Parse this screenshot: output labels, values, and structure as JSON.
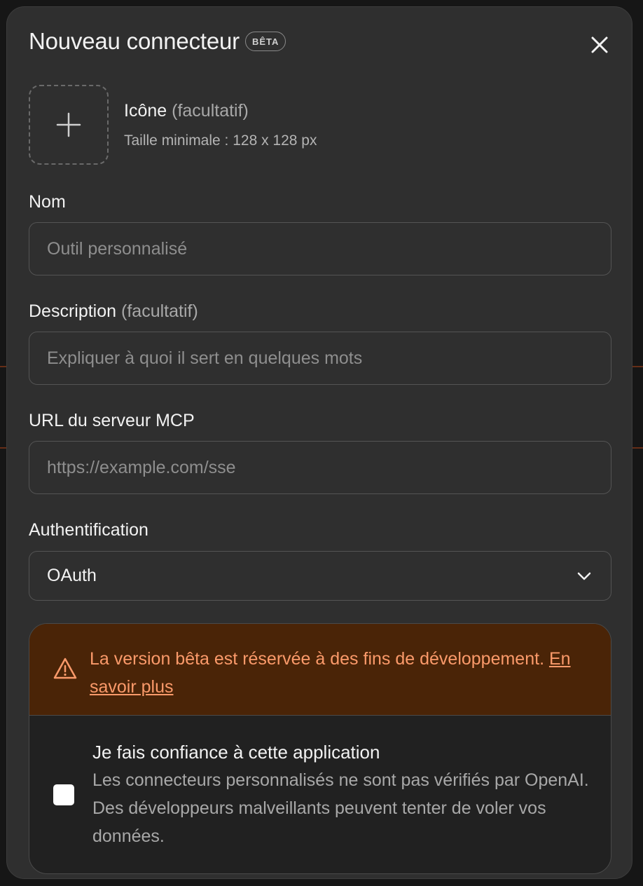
{
  "modal": {
    "title": "Nouveau connecteur",
    "badge": "BÊTA"
  },
  "icon_section": {
    "label": "Icône",
    "optional": "(facultatif)",
    "hint": "Taille minimale : 128 x 128 px"
  },
  "name_field": {
    "label": "Nom",
    "placeholder": "Outil personnalisé",
    "value": ""
  },
  "description_field": {
    "label": "Description",
    "optional": "(facultatif)",
    "placeholder": "Expliquer à quoi il sert en quelques mots",
    "value": ""
  },
  "url_field": {
    "label": "URL du serveur MCP",
    "placeholder": "https://example.com/sse",
    "value": ""
  },
  "auth_field": {
    "label": "Authentification",
    "selected": "OAuth"
  },
  "warning": {
    "text": "La version bêta est réservée à des fins de développement.",
    "link": "En savoir plus"
  },
  "trust": {
    "title": "Je fais confiance à cette application",
    "description": "Les connecteurs personnalisés ne sont pas vérifiés par OpenAI. Des développeurs malveillants peuvent tenter de voler vos données.",
    "checked": false
  },
  "icons": {
    "close": "close-icon",
    "add": "plus-icon",
    "dropdown": "chevron-down-icon",
    "warning": "warning-triangle-icon"
  },
  "colors": {
    "modal_bg": "#2f2f2f",
    "warning_bg": "#4a2407",
    "warning_text": "#fb9a6a"
  }
}
